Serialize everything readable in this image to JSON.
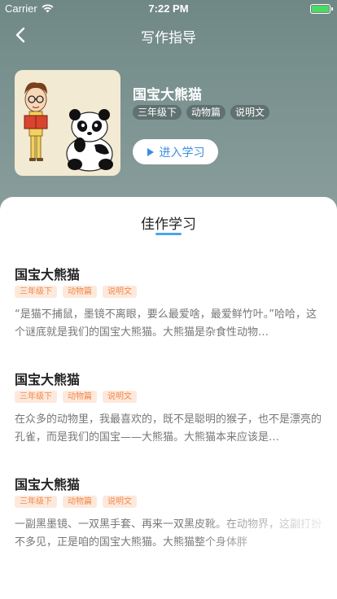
{
  "status_bar": {
    "carrier": "Carrier",
    "time": "7:22 PM"
  },
  "nav": {
    "title": "写作指导"
  },
  "book": {
    "title": "国宝大熊猫",
    "tags": [
      "三年级下",
      "动物篇",
      "说明文"
    ],
    "enter_label": "进入学习"
  },
  "section": {
    "title": "佳作学习"
  },
  "articles": [
    {
      "title": "国宝大熊猫",
      "tags": [
        "三年级下",
        "动物篇",
        "说明文"
      ],
      "desc": "“是猫不捕鼠，墨镜不离眼，要么最爱啥，最爱鲜竹叶。”哈哈，这个谜底就是我们的国宝大熊猫。大熊猫是杂食性动物…"
    },
    {
      "title": "国宝大熊猫",
      "tags": [
        "三年级下",
        "动物篇",
        "说明文"
      ],
      "desc": "在众多的动物里，我最喜欢的，既不是聪明的猴子，也不是漂亮的孔雀，而是我们的国宝——大熊猫。大熊猫本来应该是…"
    },
    {
      "title": "国宝大熊猫",
      "tags": [
        "三年级下",
        "动物篇",
        "说明文"
      ],
      "desc": "一副黑墨镜、一双黑手套、再来一双黑皮靴。在动物界，这副打扮不多见，正是咱的国宝大熊猫。大熊猫整个身体胖"
    }
  ],
  "colors": {
    "accent": "#49a7e8",
    "tag_bg": "#fde9dc",
    "tag_text": "#f08a4b",
    "header": "#7e9593"
  }
}
